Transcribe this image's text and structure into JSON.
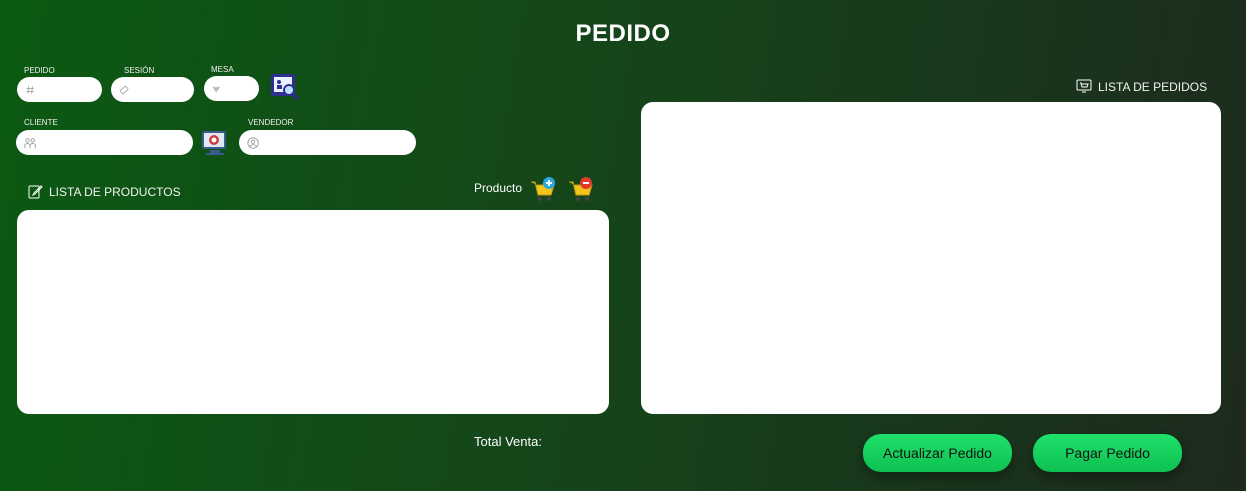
{
  "title": "PEDIDO",
  "fields": {
    "pedido": {
      "label": "PEDIDO",
      "value": "",
      "icon": "hash-icon"
    },
    "sesion": {
      "label": "SESIÓN",
      "value": "",
      "icon": "ticket-icon"
    },
    "mesa": {
      "label": "MESA",
      "value": "",
      "icon": "table-icon"
    },
    "cliente": {
      "label": "CLIENTE",
      "value": "",
      "icon": "people-icon"
    },
    "vendedor": {
      "label": "VENDEDOR",
      "value": "",
      "icon": "user-circle-icon"
    }
  },
  "productos": {
    "label": "LISTA DE PRODUCTOS",
    "producto_label": "Producto"
  },
  "pedidos": {
    "label": "LISTA DE PEDIDOS"
  },
  "total": {
    "label": "Total Venta:",
    "value": ""
  },
  "buttons": {
    "actualizar": "Actualizar Pedido",
    "pagar": "Pagar Pedido"
  },
  "colors": {
    "accent": "#12cf5c",
    "bg_start": "#0b5a12",
    "bg_end": "#1d2a1d"
  }
}
